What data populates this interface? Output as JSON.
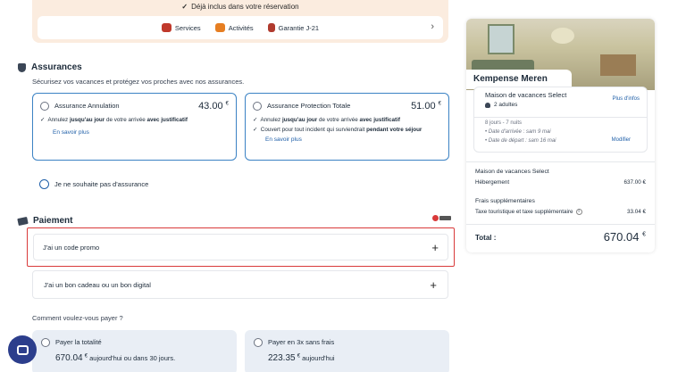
{
  "included": {
    "header": "Déjà inclus dans votre réservation",
    "items": [
      {
        "label": "Services",
        "icon": "services-icon",
        "color": "#c0392b"
      },
      {
        "label": "Activités",
        "icon": "activities-icon",
        "color": "#e67e22"
      },
      {
        "label": "Garantie J-21",
        "icon": "guarantee-icon",
        "color": "#b03a2e"
      }
    ]
  },
  "insurance": {
    "title": "Assurances",
    "subtitle": "Sécurisez vos vacances et protégez vos proches avec nos assurances.",
    "options": [
      {
        "name": "Assurance Annulation",
        "price": "43.00",
        "currency": "€",
        "bullets": [
          {
            "pre": "Annulez ",
            "bold1": "jusqu'au jour",
            "mid": " de votre arrivée ",
            "bold2": "avec justificatif"
          }
        ],
        "more": "En savoir plus"
      },
      {
        "name": "Assurance Protection Totale",
        "price": "51.00",
        "currency": "€",
        "bullets": [
          {
            "pre": "Annulez ",
            "bold1": "jusqu'au jour",
            "mid": " de votre arrivée ",
            "bold2": "avec justificatif"
          },
          {
            "pre": "Couvert pour tout incident qui surviendrait ",
            "bold1": "pendant",
            "mid": " ",
            "bold2": "votre séjour"
          }
        ],
        "more": "En savoir plus"
      }
    ],
    "none_label": "Je ne souhaite pas d'assurance"
  },
  "payment": {
    "title": "Paiement",
    "promo_label": "J'ai un code promo",
    "gift_label": "J'ai un bon cadeau ou un bon digital",
    "question": "Comment voulez-vous payer ?",
    "options": [
      {
        "name": "Payer la totalité",
        "amount": "670.04",
        "currency": "€",
        "note": "aujourd'hui ou dans 30 jours."
      },
      {
        "name": "Payer en 3x sans frais",
        "amount": "223.35",
        "currency": "€",
        "note": "aujourd'hui"
      }
    ]
  },
  "summary": {
    "park": "Kempense Meren",
    "accommodation": "Maison de vacances Select",
    "guests": "2 adultes",
    "more_info": "Plus d'infos",
    "nights": "8 jours - 7 nuits",
    "arrival": "Date d'arrivée : sam 9 mai",
    "departure": "Date de départ : sam 16 mai",
    "modify": "Modifier",
    "section1_title": "Maison de vacances Select",
    "lodging_label": "Hébergement",
    "lodging_value": "637.00 €",
    "section2_title": "Frais supplémentaires",
    "tax_label": "Taxe touristique et taxe supplémentaire",
    "tax_value": "33.04 €",
    "total_label": "Total :",
    "total_value": "670.04",
    "currency": "€"
  }
}
